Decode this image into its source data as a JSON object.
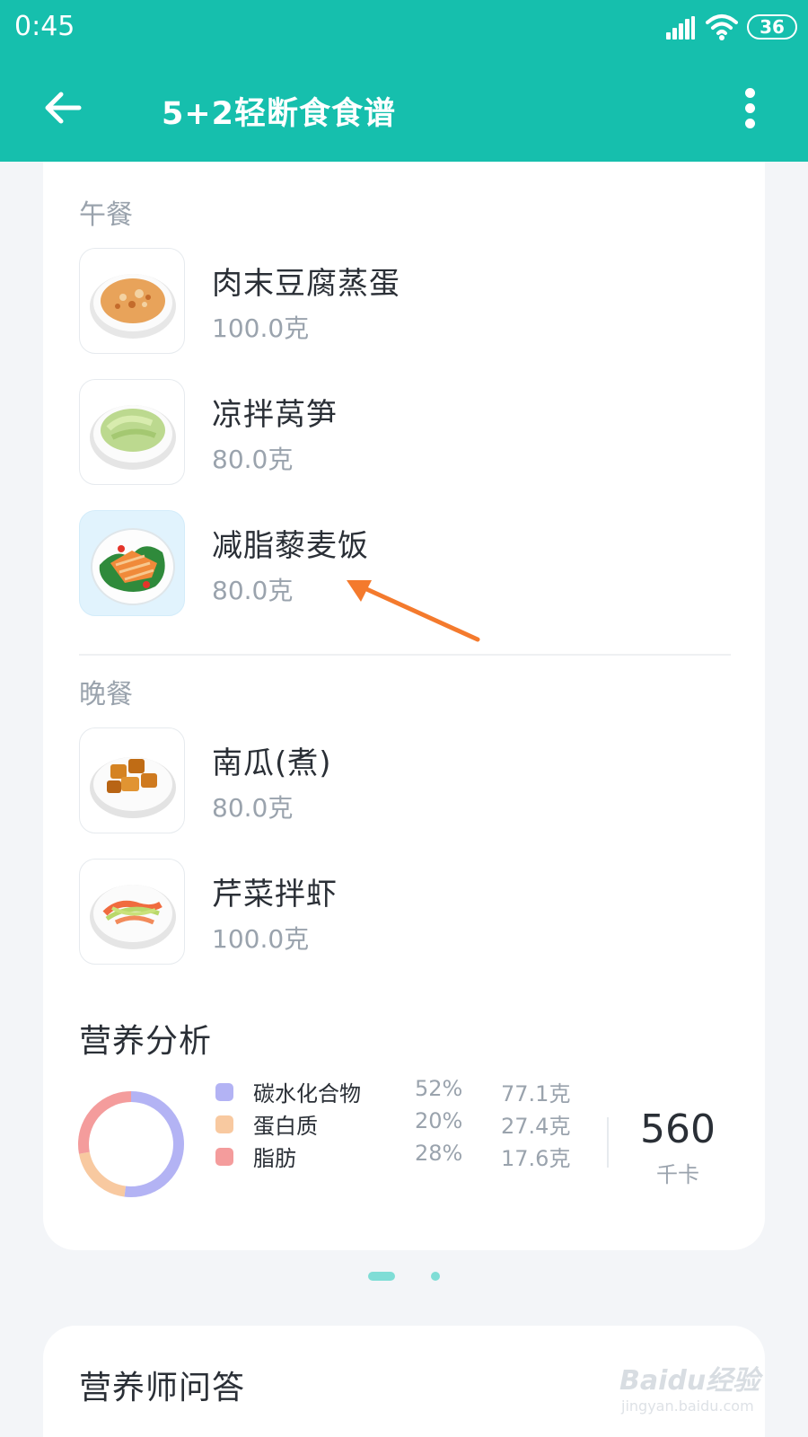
{
  "status_bar": {
    "time": "0:45",
    "battery": "36",
    "icons": [
      "signal-icon",
      "wifi-icon",
      "battery-icon"
    ]
  },
  "app_bar": {
    "title": "5+2轻断食食谱",
    "back_icon": "arrow-left-icon",
    "more_icon": "more-vertical-icon"
  },
  "lunch": {
    "label": "午餐",
    "items": [
      {
        "name": "肉末豆腐蒸蛋",
        "weight": "100.0克"
      },
      {
        "name": "凉拌莴笋",
        "weight": "80.0克"
      },
      {
        "name": "减脂藜麦饭",
        "weight": "80.0克"
      }
    ]
  },
  "dinner": {
    "label": "晚餐",
    "items": [
      {
        "name": "南瓜(煮)",
        "weight": "80.0克"
      },
      {
        "name": "芹菜拌虾",
        "weight": "100.0克"
      }
    ]
  },
  "nutrition": {
    "title": "营养分析",
    "rows": [
      {
        "name": "碳水化合物",
        "percent": "52%",
        "amount": "77.1克",
        "color": "#b3b3f4"
      },
      {
        "name": "蛋白质",
        "percent": "20%",
        "amount": "27.4克",
        "color": "#f8c9a0"
      },
      {
        "name": "脂肪",
        "percent": "28%",
        "amount": "17.6克",
        "color": "#f49c9c"
      }
    ],
    "kcal": "560",
    "kcal_unit": "千卡"
  },
  "pager": {
    "pages": 2,
    "active": 1,
    "color": "#7fddd6"
  },
  "qa": {
    "title": "营养师问答"
  },
  "watermark": {
    "text": "Baidu经验",
    "url": "jingyan.baidu.com"
  },
  "colors": {
    "accent": "#16bfad",
    "annotation_arrow": "#f47a2d"
  }
}
